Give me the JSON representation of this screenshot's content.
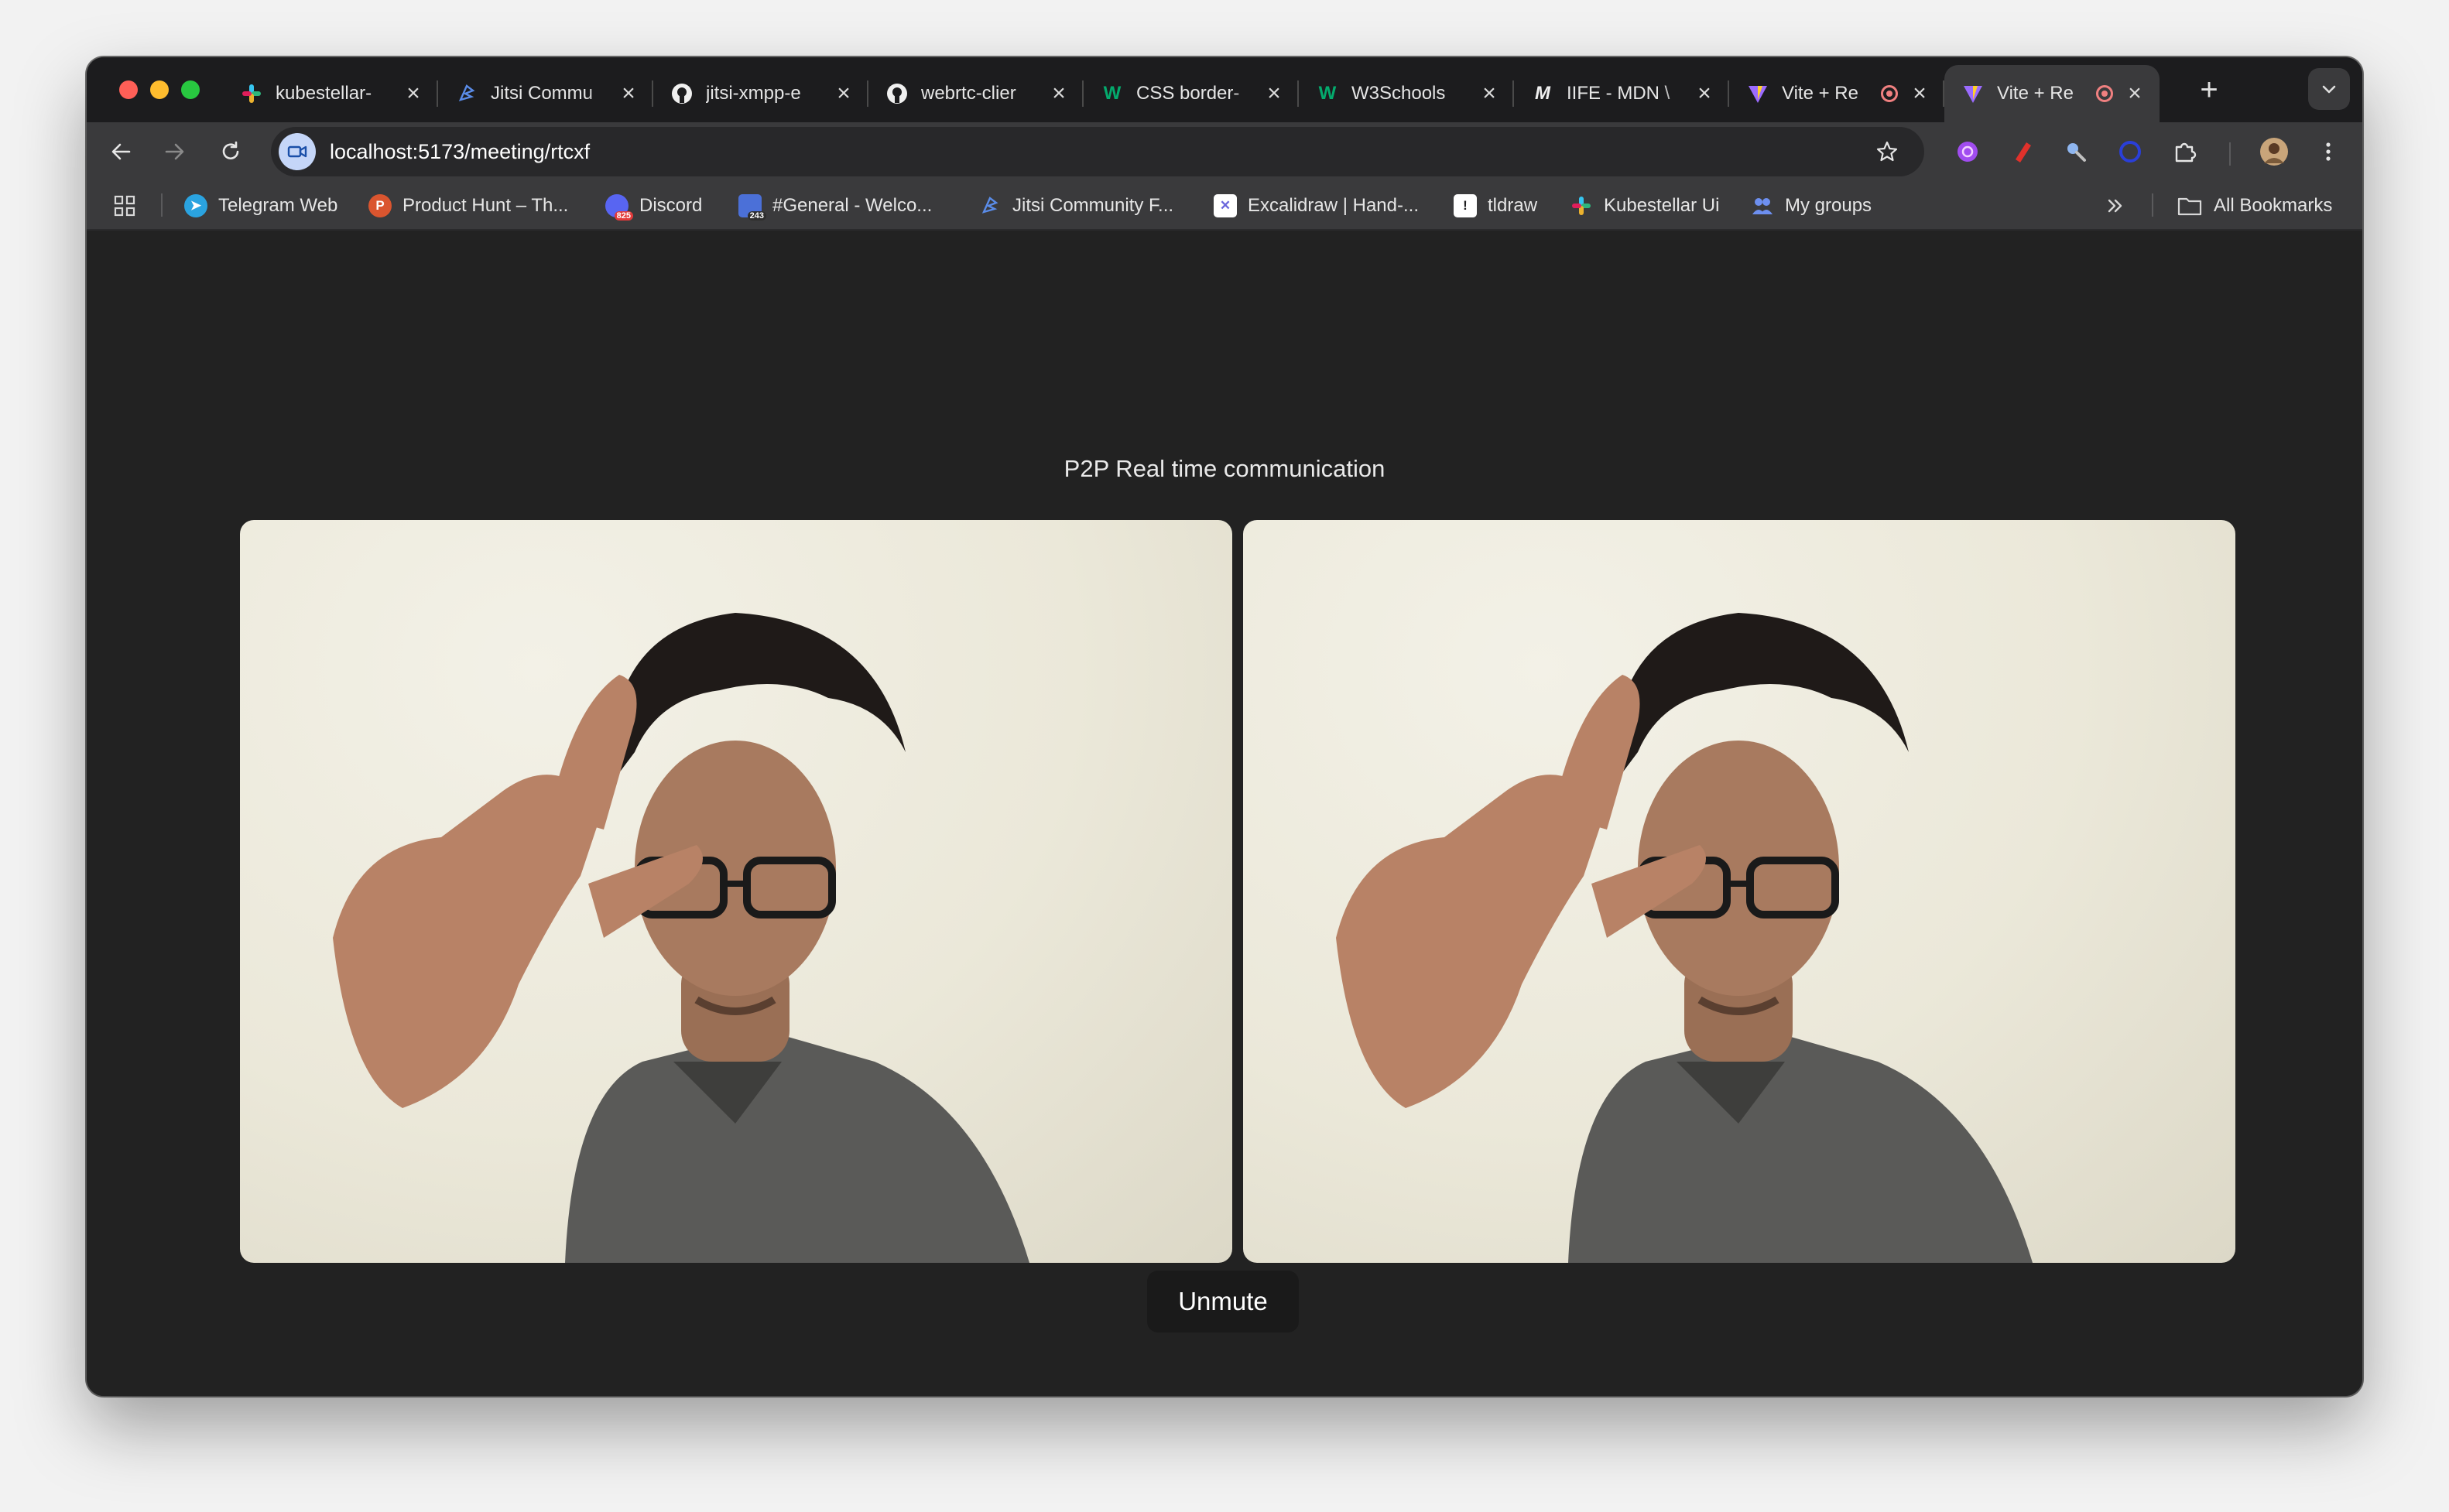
{
  "browser": {
    "tabs": [
      {
        "title": "kubestellar-",
        "icon": "slack-icon"
      },
      {
        "title": "Jitsi Commu",
        "icon": "jitsi-icon"
      },
      {
        "title": "jitsi-xmpp-e",
        "icon": "github-icon"
      },
      {
        "title": "webrtc-clier",
        "icon": "github-icon"
      },
      {
        "title": "CSS border-",
        "icon": "w3schools-icon"
      },
      {
        "title": "W3Schools",
        "icon": "w3schools-icon"
      },
      {
        "title": "IIFE - MDN \\",
        "icon": "mdn-icon"
      },
      {
        "title": "Vite + Re",
        "icon": "vite-icon",
        "recording": true
      },
      {
        "title": "Vite + Re",
        "icon": "vite-icon",
        "recording": true,
        "active": true
      }
    ],
    "url": "localhost:5173/meeting/rtcxf",
    "bookmarks": [
      {
        "label": "Telegram Web",
        "icon": "telegram-icon"
      },
      {
        "label": "Product Hunt – Th...",
        "icon": "product-hunt-icon"
      },
      {
        "label": "Discord",
        "icon": "discord-icon",
        "badge": "825"
      },
      {
        "label": "#General - Welco...",
        "icon": "calendar-icon",
        "badge": "243"
      },
      {
        "label": "Jitsi Community F...",
        "icon": "jitsi-icon"
      },
      {
        "label": "Excalidraw | Hand-...",
        "icon": "excalidraw-icon"
      },
      {
        "label": "tldraw",
        "icon": "tldraw-icon"
      },
      {
        "label": "Kubestellar Ui",
        "icon": "slack-icon"
      },
      {
        "label": "My groups",
        "icon": "groups-icon"
      }
    ],
    "all_bookmarks_label": "All Bookmarks",
    "colors": {
      "tab_strip": "#1c1c1e",
      "toolbar": "#3a3a3c",
      "page_background": "#222222"
    }
  },
  "page": {
    "title": "P2P Real time communication",
    "videos": [
      {
        "name": "local-video"
      },
      {
        "name": "remote-video"
      }
    ],
    "unmute_label": "Unmute"
  }
}
